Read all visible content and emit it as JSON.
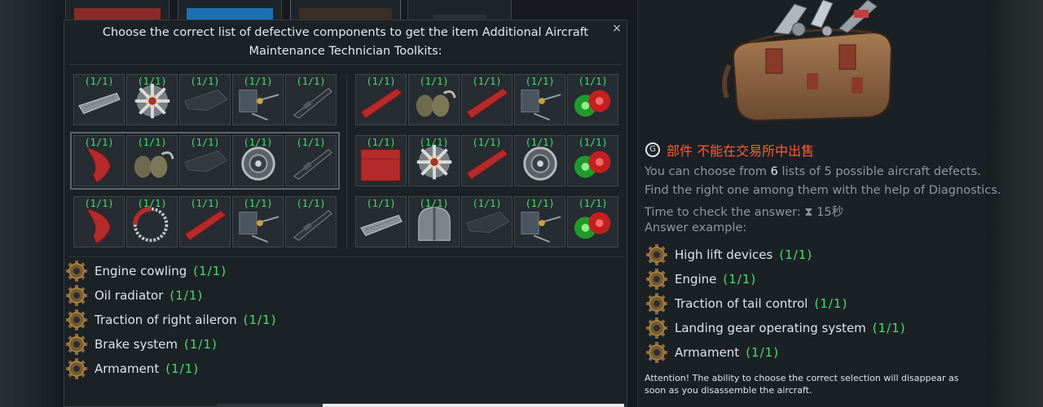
{
  "popup": {
    "title": "Choose the correct list of defective components to get the item Additional Aircraft Maintenance Technician Toolkits:",
    "close_symbol": "×"
  },
  "grid": {
    "count_label": "(1/1)",
    "left": [
      [
        "metal-sheet",
        "radial-engine",
        "wing-panel",
        "tail-control",
        "gun"
      ],
      [
        "red-flap",
        "oil-radiator",
        "wing-panel",
        "brake-drum",
        "gun"
      ],
      [
        "red-flap",
        "aileron-ring",
        "red-aileron",
        "tail-control",
        "gun"
      ]
    ],
    "right": [
      [
        "red-aileron",
        "oil-radiator",
        "red-aileron",
        "tail-control",
        "nav-lights"
      ],
      [
        "red-panel",
        "radial-engine",
        "red-aileron",
        "brake-drum",
        "nav-lights"
      ],
      [
        "metal-sheet",
        "cowling",
        "wing-panel",
        "tail-control",
        "nav-lights"
      ]
    ],
    "selected_row": 1
  },
  "required_components": [
    {
      "name": "Engine cowling",
      "count": "(1/1)"
    },
    {
      "name": "Oil radiator",
      "count": "(1/1)"
    },
    {
      "name": "Traction of right aileron",
      "count": "(1/1)"
    },
    {
      "name": "Brake system",
      "count": "(1/1)"
    },
    {
      "name": "Armament",
      "count": "(1/1)"
    }
  ],
  "right_panel": {
    "market_icon": "G",
    "market_text": "部件 不能在交易所中出售",
    "desc_line1_pre": "You can choose from ",
    "desc_line1_num": "6",
    "desc_line1_post": " lists of 5 possible aircraft defects.",
    "desc_line2": "Find the right one among them with the help of Diagnostics.",
    "desc_line3_pre": "Time to check the answer: ",
    "desc_line3_icon": "⧗",
    "desc_line3_value": "15秒",
    "desc_line4": "Answer example:",
    "example": [
      {
        "name": "High lift devices",
        "count": "(1/1)"
      },
      {
        "name": "Engine",
        "count": "(1/1)"
      },
      {
        "name": "Traction of tail control",
        "count": "(1/1)"
      },
      {
        "name": "Landing gear operating system",
        "count": "(1/1)"
      },
      {
        "name": "Armament",
        "count": "(1/1)"
      }
    ],
    "attention": "Attention! The ability to choose the correct selection will disappear as soon as you disassemble the aircraft."
  },
  "colors": {
    "count_green": "#3fe06a",
    "market_red": "#ff5a32",
    "panel_bg": "#1c2126"
  },
  "icons": {
    "gear": "gear-icon",
    "close": "close-icon",
    "hourglass": "hourglass-icon",
    "marketplace": "marketplace-icon"
  }
}
